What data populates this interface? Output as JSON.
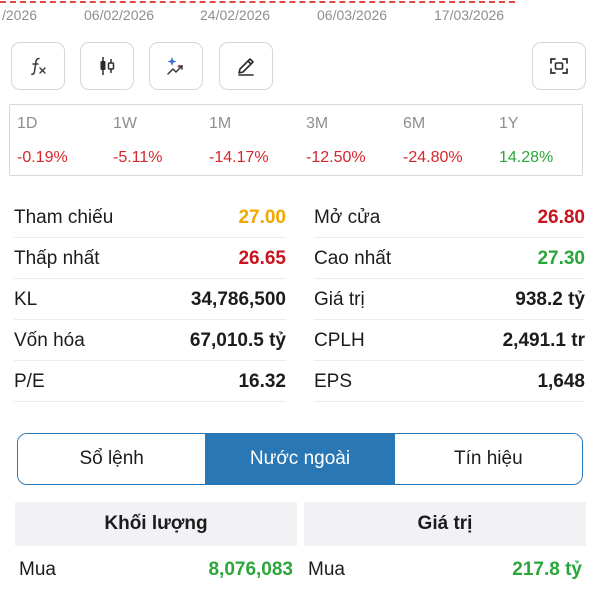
{
  "date_axis": {
    "dates": [
      "/2026",
      "06/02/2026",
      "24/02/2026",
      "06/03/2026",
      "17/03/2026"
    ]
  },
  "toolbar": {
    "tools": [
      {
        "name": "function-icon"
      },
      {
        "name": "candlestick-icon"
      },
      {
        "name": "ai-sparkle-icon"
      },
      {
        "name": "pencil-icon"
      },
      {
        "name": "screenshot-scan-icon"
      }
    ]
  },
  "periods": [
    {
      "label": "1D",
      "change": "-0.19%",
      "trend": "neg"
    },
    {
      "label": "1W",
      "change": "-5.11%",
      "trend": "neg"
    },
    {
      "label": "1M",
      "change": "-14.17%",
      "trend": "neg"
    },
    {
      "label": "3M",
      "change": "-12.50%",
      "trend": "neg"
    },
    {
      "label": "6M",
      "change": "-24.80%",
      "trend": "neg"
    },
    {
      "label": "1Y",
      "change": "14.28%",
      "trend": "pos"
    }
  ],
  "stats": {
    "left": [
      {
        "key": "Tham chiếu",
        "value": "27.00",
        "color": "yellow"
      },
      {
        "key": "Thấp nhất",
        "value": "26.65",
        "color": "red"
      },
      {
        "key": "KL",
        "value": "34,786,500",
        "color": "black"
      },
      {
        "key": "Vốn hóa",
        "value": "67,010.5 tỷ",
        "color": "black"
      },
      {
        "key": "P/E",
        "value": "16.32",
        "color": "black"
      }
    ],
    "right": [
      {
        "key": "Mở cửa",
        "value": "26.80",
        "color": "red"
      },
      {
        "key": "Cao nhất",
        "value": "27.30",
        "color": "green"
      },
      {
        "key": "Giá trị",
        "value": "938.2 tỷ",
        "color": "black"
      },
      {
        "key": "CPLH",
        "value": "2,491.1 tr",
        "color": "black"
      },
      {
        "key": "EPS",
        "value": "1,648",
        "color": "black"
      }
    ]
  },
  "tabs": {
    "order_book": "Sổ lệnh",
    "foreign": "Nước ngoài",
    "signals": "Tín hiệu",
    "active": "foreign"
  },
  "foreign_table": {
    "volume_header": "Khối lượng",
    "value_header": "Giá trị",
    "buy_label_volume": "Mua",
    "buy_volume": "8,076,083",
    "buy_label_value": "Mua",
    "buy_value": "217.8 tỷ"
  },
  "colors": {
    "accent": "#2a77b6",
    "up": "#2aa63a",
    "down": "#c8141e",
    "reference": "#f0a800",
    "axis_dash": "#e04848"
  }
}
